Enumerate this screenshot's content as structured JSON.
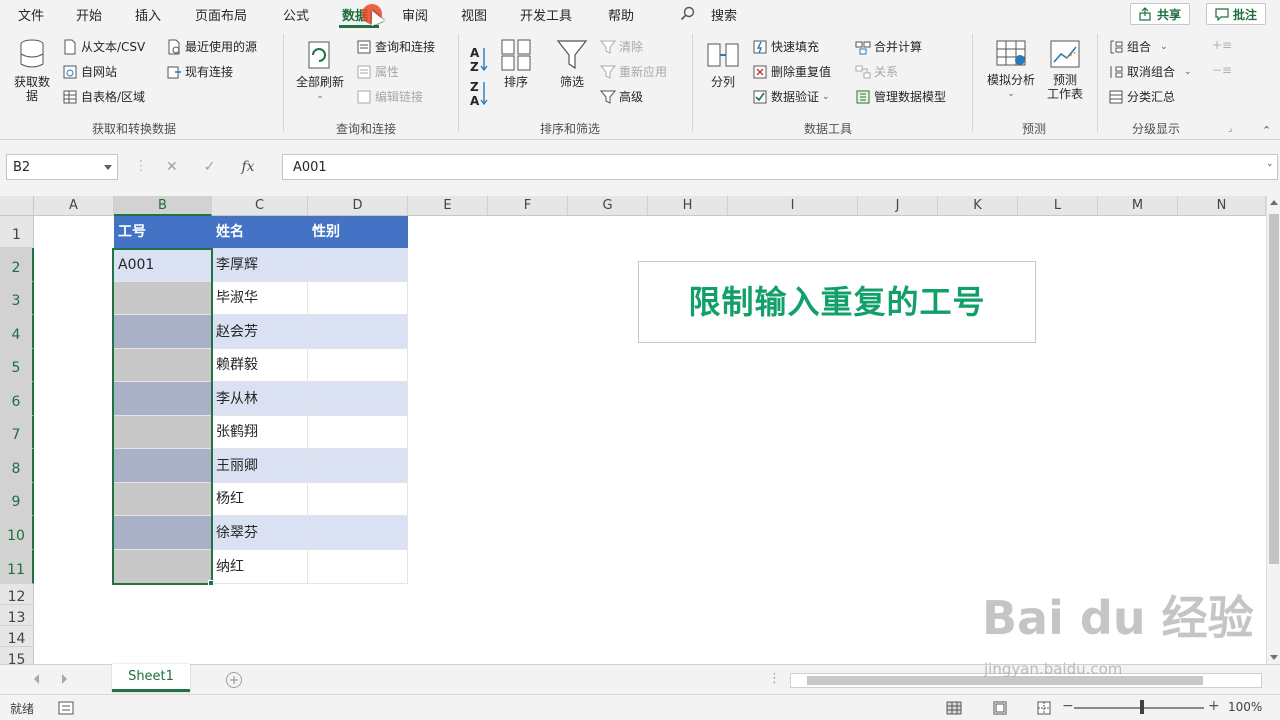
{
  "menu": {
    "tabs": [
      "文件",
      "开始",
      "插入",
      "页面布局",
      "公式",
      "数据",
      "审阅",
      "视图",
      "开发工具",
      "帮助"
    ],
    "search_label": "搜索",
    "share_label": "共享",
    "comment_label": "批注"
  },
  "ribbon": {
    "get_transform": {
      "get_data": "获取数\n据",
      "from_text_csv": "从文本/CSV",
      "from_web": "自网站",
      "from_table": "自表格/区域",
      "recent_sources": "最近使用的源",
      "existing_connections": "现有连接",
      "group_label": "获取和转换数据"
    },
    "queries": {
      "refresh_all": "全部刷新",
      "queries_connections": "查询和连接",
      "properties": "属性",
      "edit_links": "编辑链接",
      "group_label": "查询和连接"
    },
    "sort_filter": {
      "sort": "排序",
      "filter": "筛选",
      "clear": "清除",
      "reapply": "重新应用",
      "advanced": "高级",
      "group_label": "排序和筛选"
    },
    "data_tools": {
      "text_to_columns": "分列",
      "flash_fill": "快速填充",
      "remove_duplicates": "删除重复值",
      "data_validation": "数据验证",
      "consolidate": "合并计算",
      "relationships": "关系",
      "manage_data_model": "管理数据模型",
      "group_label": "数据工具"
    },
    "forecast": {
      "what_if": "模拟分析",
      "forecast_sheet": "预测\n工作表",
      "group_label": "预测"
    },
    "outline": {
      "group": "组合",
      "ungroup": "取消组合",
      "subtotal": "分类汇总",
      "group_label": "分级显示"
    }
  },
  "formula_bar": {
    "name_box": "B2",
    "fx": "fx",
    "formula": "A001"
  },
  "sheet": {
    "columns": [
      "A",
      "B",
      "C",
      "D",
      "E",
      "F",
      "G",
      "H",
      "I",
      "J",
      "K",
      "L",
      "M",
      "N"
    ],
    "rows": [
      "1",
      "2",
      "3",
      "4",
      "5",
      "6",
      "7",
      "8",
      "9",
      "10",
      "11",
      "12",
      "13",
      "14",
      "15"
    ],
    "headers": [
      "工号",
      "姓名",
      "性别"
    ],
    "ids": [
      "A001",
      "",
      "",
      "",
      "",
      "",
      "",
      "",
      "",
      ""
    ],
    "names": [
      "李厚辉",
      "毕淑华",
      "赵会芳",
      "赖群毅",
      "李从林",
      "张鹤翔",
      "王丽卿",
      "杨红",
      "徐翠芬",
      "纳红"
    ],
    "title_note": "限制输入重复的工号"
  },
  "tabs": {
    "sheet1": "Sheet1",
    "add": "+"
  },
  "status": {
    "ready": "就绪",
    "zoom": "100%"
  },
  "watermark": {
    "brand": "Bai du 经验",
    "url": "jingyan.baidu.com"
  },
  "colors": {
    "accent": "#217346",
    "table_header": "#4472c4",
    "band": "#d9e1f2",
    "title_text": "#12a06a"
  }
}
